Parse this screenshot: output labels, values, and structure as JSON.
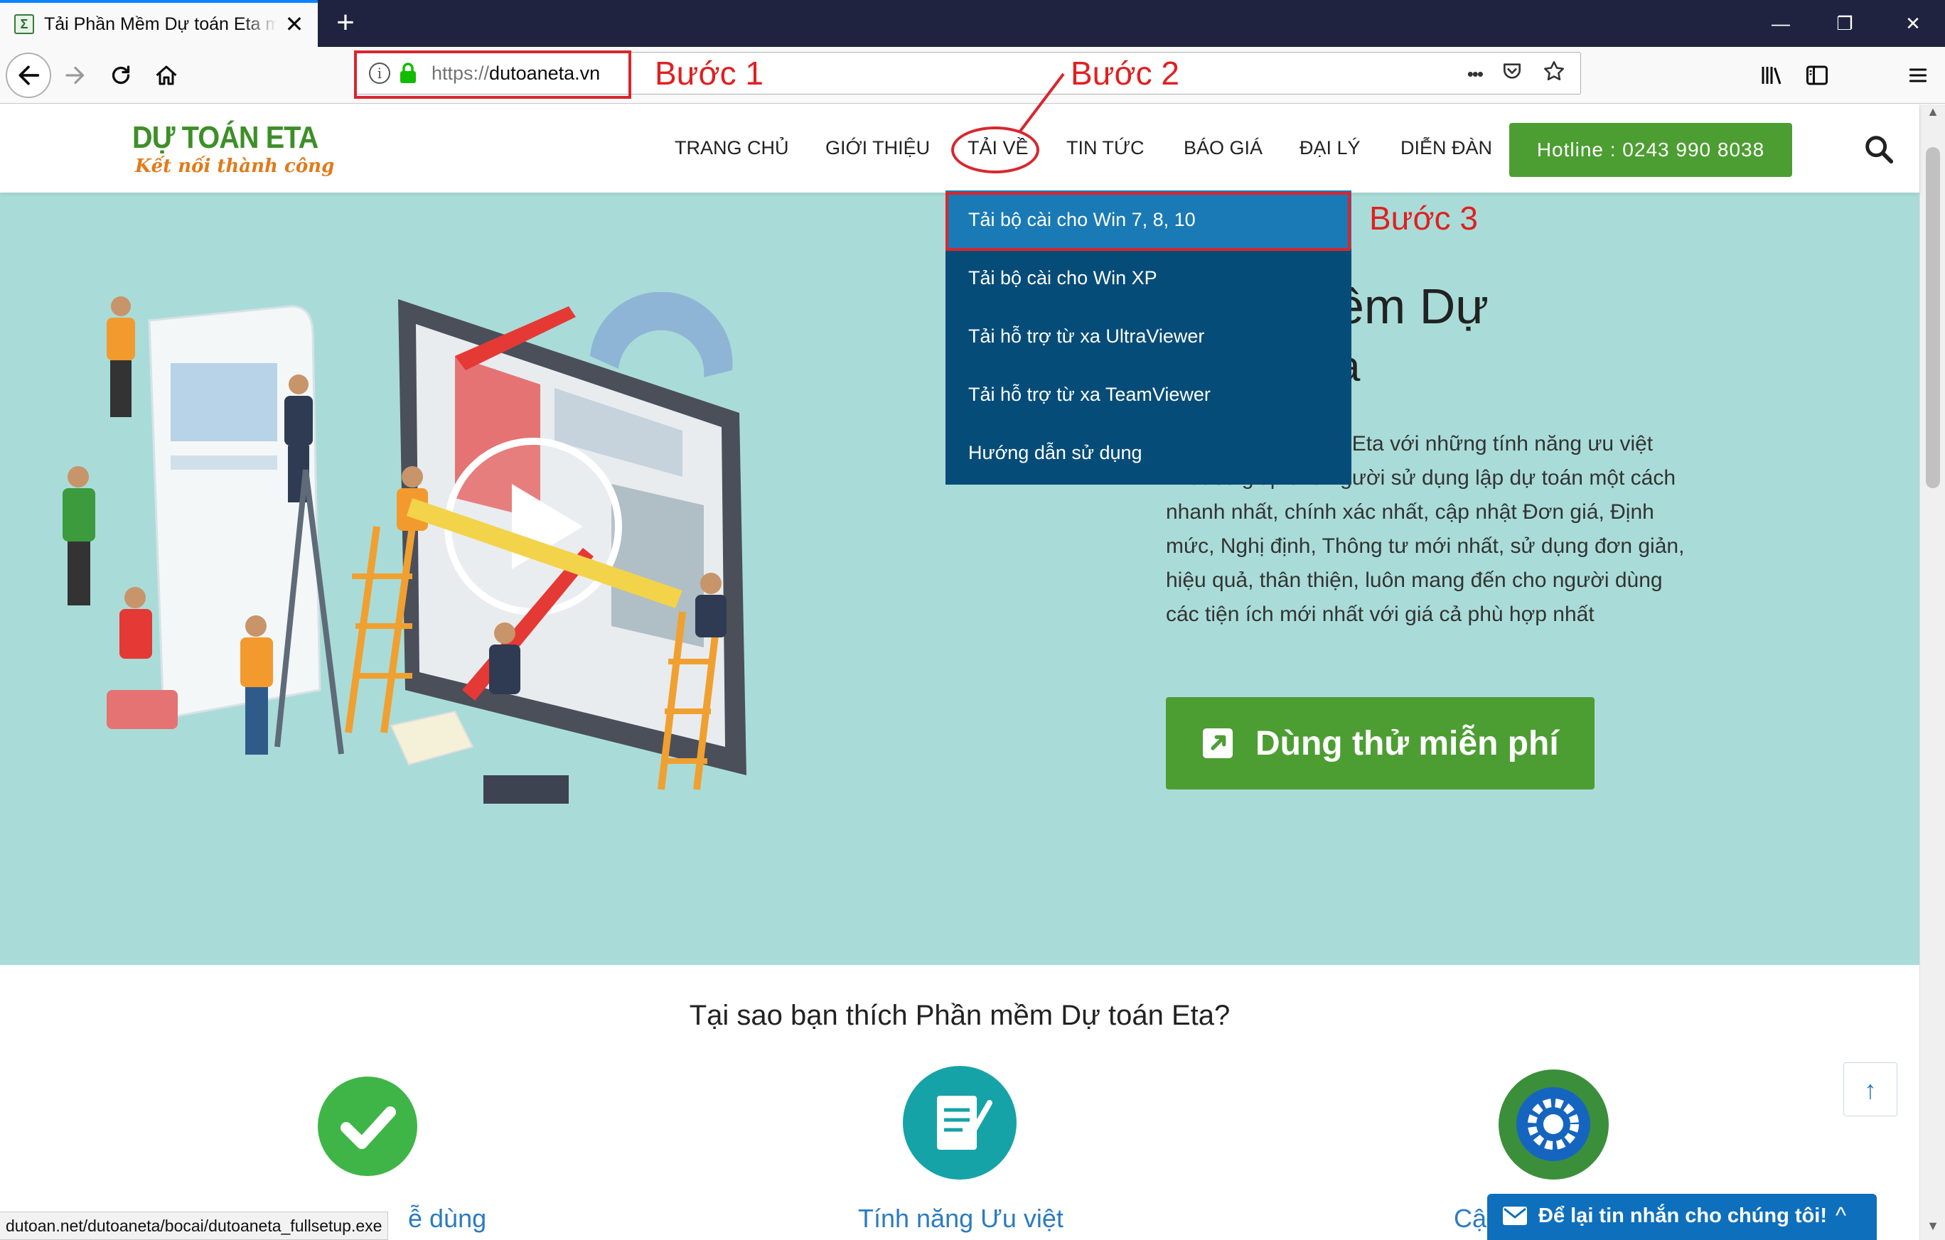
{
  "browser": {
    "tab_title": "Tải Phần Mềm Dự toán Eta miễn phí",
    "tab_favicon": "Σ",
    "close_glyph": "✕",
    "new_tab_glyph": "+",
    "url_scheme": "https://",
    "url_host": "dutoaneta.vn",
    "page_actions_glyph": "•••",
    "window_controls": {
      "minimize": "—",
      "restore": "❐",
      "close": "✕"
    },
    "toolbar_icons": [
      "back-icon",
      "forward-icon",
      "reload-icon",
      "home-icon",
      "info-icon",
      "lock-icon",
      "more-actions-icon",
      "pocket-icon",
      "bookmark-star-icon",
      "library-icon",
      "sidebar-icon",
      "menu-icon"
    ]
  },
  "site": {
    "logo_title": "DỰ TOÁN ETA",
    "logo_slogan": "Kết nối thành công",
    "menu": [
      "TRANG CHỦ",
      "GIỚI THIỆU",
      "TẢI VỀ",
      "TIN TỨC",
      "BÁO GIÁ",
      "ĐẠI LÝ",
      "DIỄN ĐÀN"
    ],
    "hotline": "Hotline : 0243 990 8038"
  },
  "dropdown": {
    "items": [
      "Tải bộ cài cho Win 7, 8, 10",
      "Tải bộ cài cho Win XP",
      "Tải hỗ trợ từ xa UltraViewer",
      "Tải hỗ trợ từ xa TeamViewer",
      "Hướng dẫn sử dụng"
    ],
    "active_index": 0
  },
  "annotations": {
    "step1": "Bước 1",
    "step2": "Bước 2",
    "step3": "Bước 3"
  },
  "hero": {
    "title_partial": "ềm Dự",
    "title_partial2": "a",
    "desc_lines": [
      "an Eta với những tính năng ưu việt",
      "nhất sẽ giúp cho người sử dụng lập dự toán một cách",
      "nhanh nhất, chính xác nhất, cập nhật Đơn giá, Định",
      "mức, Nghị định, Thông tư mới nhất, sử dụng đơn giản,",
      "hiệu quả, thân thiện, luôn mang đến cho người dùng",
      "các tiện ích mới nhất với giá cả phù hợp nhất"
    ],
    "cta": "Dùng thử miễn phí"
  },
  "why": {
    "title": "Tại sao bạn thích Phần mềm Dự toán Eta?",
    "features": [
      "ễ dùng",
      "Tính năng Ưu việt",
      "Cậ"
    ]
  },
  "status_url": "dutoan.net/dutoaneta/bocai/dutoaneta_fullsetup.exe",
  "chat": {
    "label": "Để lại tin nhắn cho chúng tôi!",
    "chevron": "^"
  },
  "to_top_glyph": "↑",
  "colors": {
    "tabbar": "#202340",
    "brand_green": "#4c9e32",
    "hero_bg": "#a9dcd8",
    "dropdown_bg": "#064c78",
    "dropdown_active": "#1a7ab5",
    "annotation_red": "#d9262e",
    "chat_blue": "#0e6fbc",
    "link_blue": "#2b7bc0"
  }
}
